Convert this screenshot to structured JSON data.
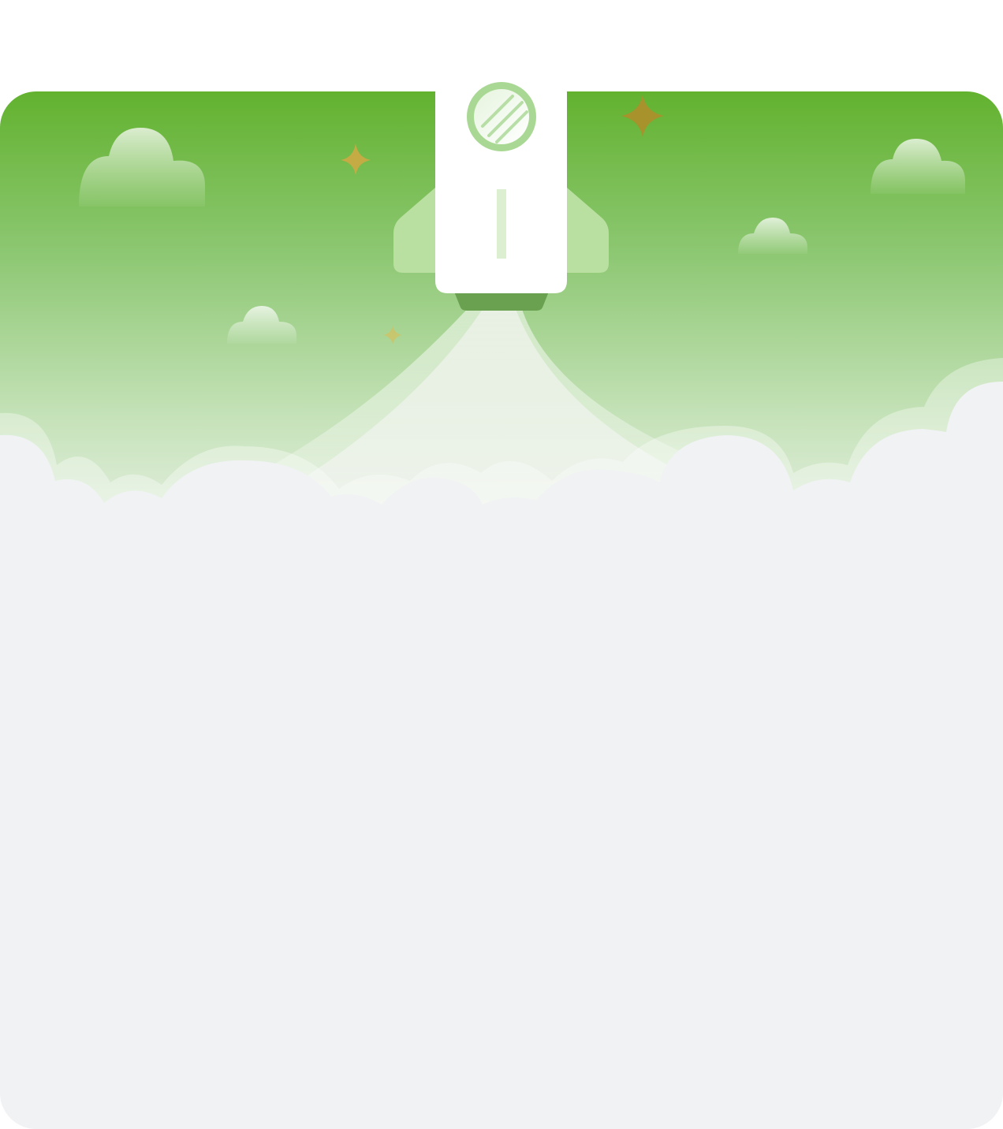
{
  "illustration": {
    "alt_description": "",
    "colors": {
      "sky_top": "#62b22f",
      "sky_mid": "#9fd087",
      "sky_bottom": "#e4efe2",
      "ground": "#f0f2f4",
      "rocket_body": "#ffffff",
      "rocket_fins": "#b9e0a0",
      "rocket_window": "#a9d894",
      "rocket_nozzle": "#6aa150",
      "star": "#d4a843",
      "star_dark": "#a7922c"
    },
    "icons": [
      "rocket-icon",
      "cloud-icon",
      "star-icon"
    ]
  }
}
